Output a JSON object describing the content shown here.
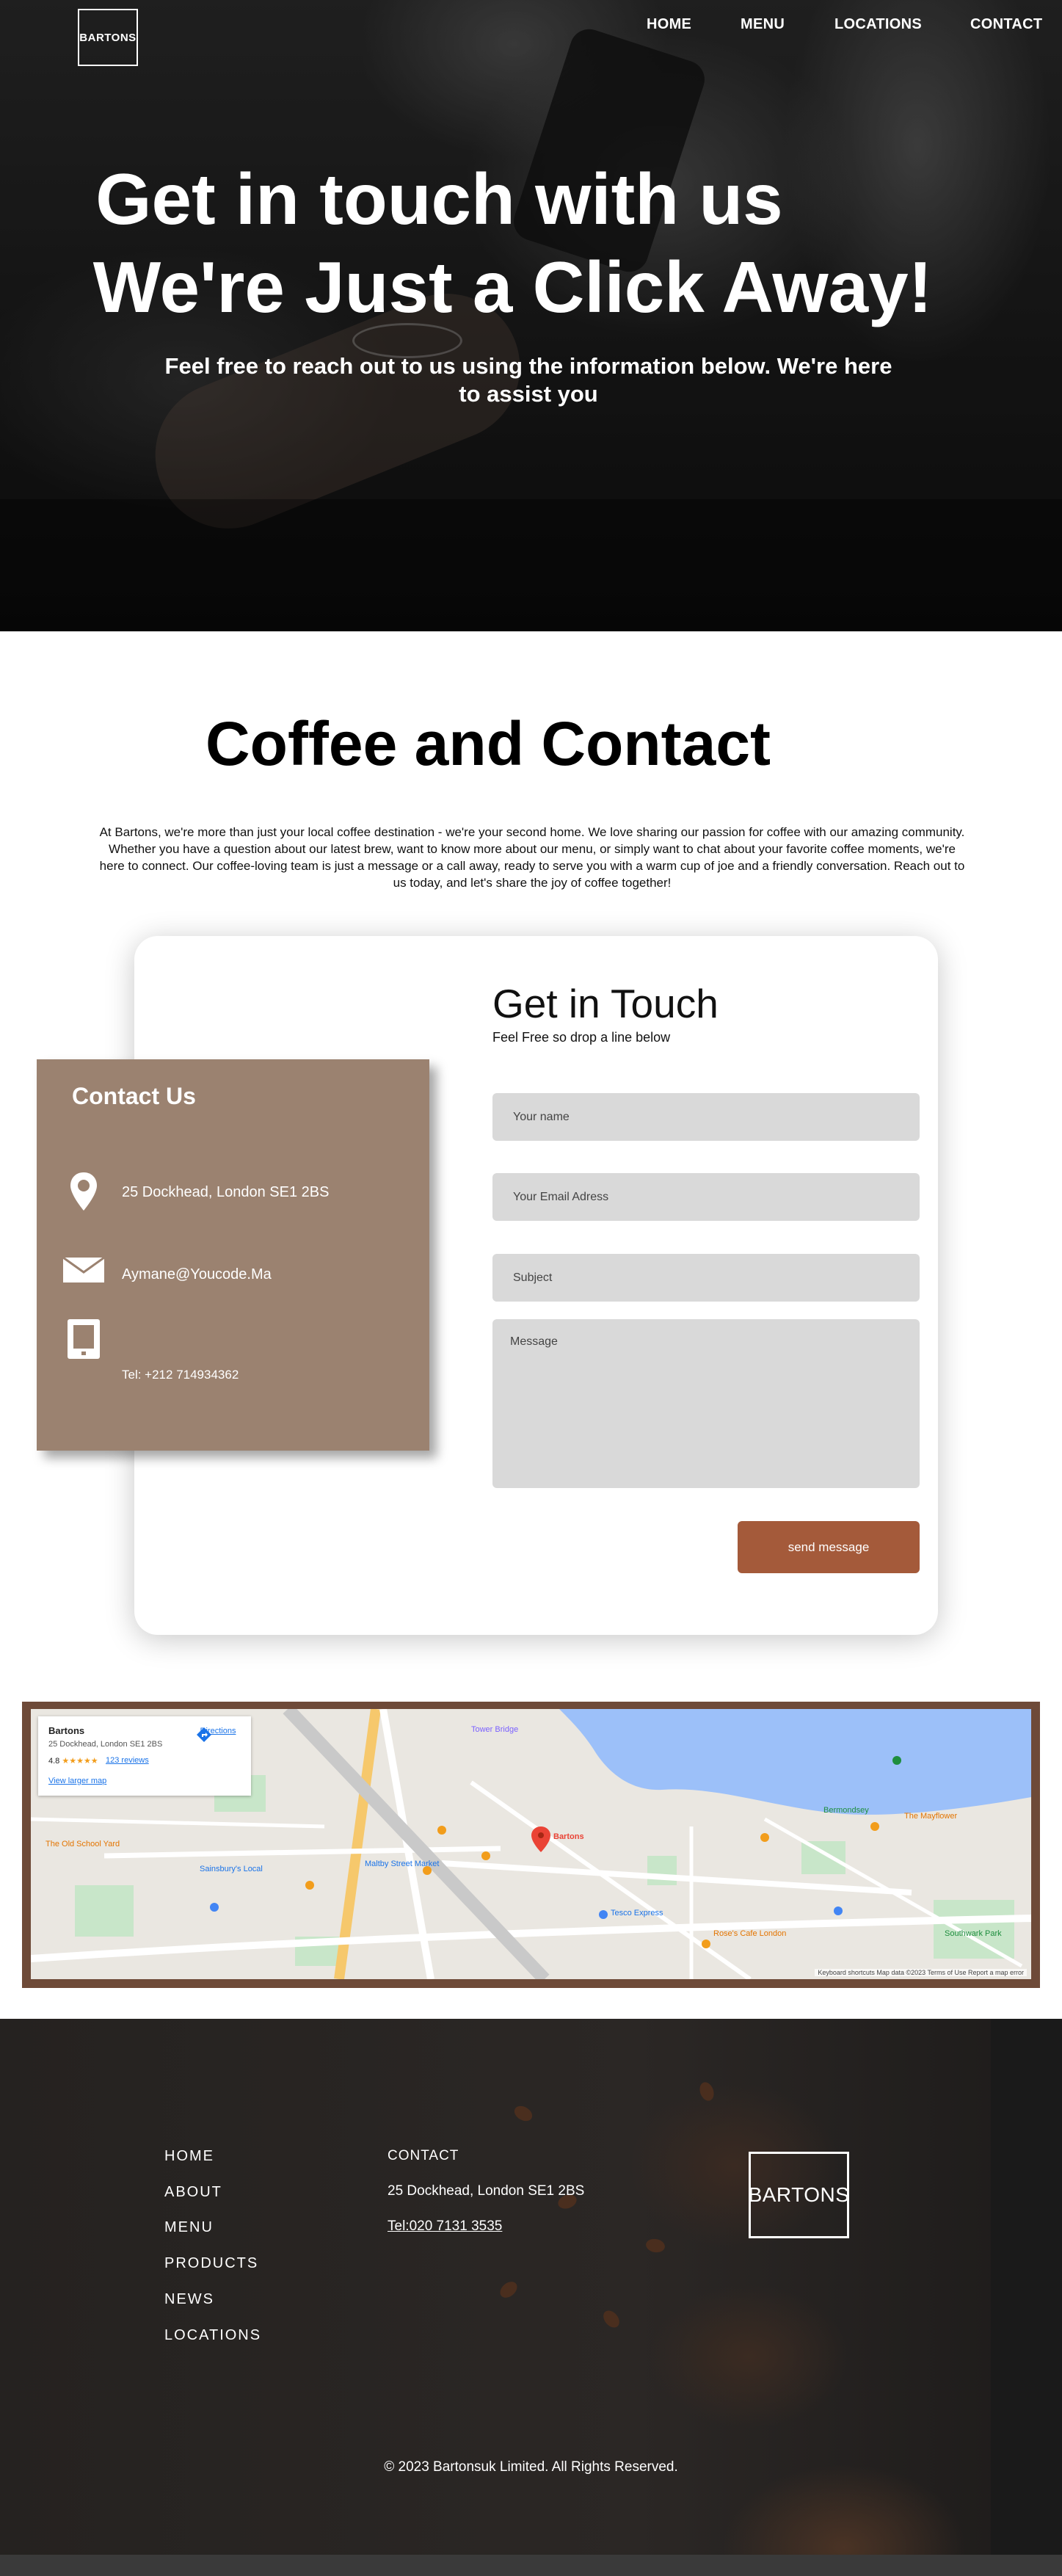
{
  "header": {
    "logo": "BARTONS",
    "nav": [
      "HOME",
      "MENU",
      "LOCATIONS",
      "CONTACT"
    ]
  },
  "hero": {
    "title_line1": "Get in touch with us",
    "title_line2": "We're Just a Click Away!",
    "subtitle": "Feel free to reach out to us using the information below. We're here to assist you"
  },
  "intro": {
    "title": "Coffee and Contact",
    "text": "At Bartons, we're more than just your local coffee destination - we're your second home. We love sharing our passion for coffee with our amazing community. Whether you have a question about our latest brew, want to know more about our menu, or simply want to chat about your favorite coffee moments, we're here to connect. Our coffee-loving team is just a message or a call away, ready to serve you with a warm cup of joe and a friendly conversation. Reach out to us today, and let's share the joy of coffee together!"
  },
  "contact_panel": {
    "title": "Contact Us",
    "address": "25 Dockhead, London SE1 2BS",
    "email": "Aymane@Youcode.Ma",
    "phone": "Tel: +212 714934362",
    "icons": [
      "map-pin-icon",
      "envelope-icon",
      "tablet-icon"
    ]
  },
  "form": {
    "title": "Get in Touch",
    "subtitle": "Feel Free so drop a line below",
    "name_placeholder": "Your name",
    "email_placeholder": "Your Email Adress",
    "subject_placeholder": "Subject",
    "message_placeholder": "Message",
    "send_label": "send message"
  },
  "map": {
    "place_name": "Bartons",
    "place_address": "25 Dockhead, London SE1 2BS",
    "rating": "4.8",
    "stars": "★★★★★",
    "reviews": "123 reviews",
    "larger_map": "View larger map",
    "directions": "Directions",
    "labels": [
      "Bartons",
      "Tower Bridge",
      "Maltby Street Market",
      "The Old School Yard",
      "Bermondsey",
      "Sainsbury's Local",
      "Tesco Express",
      "Rose's Cafe London",
      "Southwark Park",
      "The Mayflower"
    ],
    "footer_text": "Keyboard shortcuts  Map data ©2023  Terms of Use  Report a map error"
  },
  "footer": {
    "nav": [
      "HOME",
      "ABOUT",
      "MENU",
      "PRODUCTS",
      "NEWS",
      "LOCATIONS"
    ],
    "contact_title": "CONTACT",
    "address": "25 Dockhead, London SE1 2BS",
    "phone": "Tel:020 7131 3535",
    "logo": "BARTONS",
    "copyright": "© 2023 Bartonsuk Limited. All Rights Reserved."
  },
  "colors": {
    "panel_brown": "#9b8270",
    "button_brown": "#a45a3a",
    "map_frame": "#6e4a38",
    "field_gray": "#d9d9d9"
  }
}
